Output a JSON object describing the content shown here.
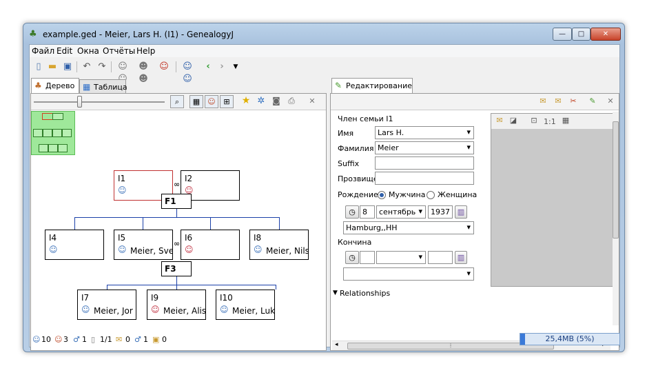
{
  "window": {
    "title": "example.ged - Meier, Lars H. (I1) - GenealogyJ",
    "controls": [
      "—",
      "□",
      "✕"
    ]
  },
  "menu": [
    "Файл",
    "Edit",
    "Окна",
    "Отчёты",
    "Help"
  ],
  "toolbar_icons": [
    "new-file-icon",
    "open-folder-icon",
    "save-icon",
    "undo-icon",
    "redo-icon",
    "people-icon",
    "family-icon",
    "add-person-icon",
    "relatives-icon",
    "back-arrow-icon",
    "forward-arrow-icon",
    "dropdown-icon"
  ],
  "left_tabs": [
    {
      "label": "Дерево",
      "active": true
    },
    {
      "label": "Таблица",
      "active": false
    }
  ],
  "tree": {
    "zoom_level": 0.33,
    "persons": [
      {
        "id": "I1",
        "name": "",
        "sex": "m",
        "selected": true
      },
      {
        "id": "I2",
        "name": "",
        "sex": "f"
      },
      {
        "id": "I4",
        "name": "",
        "sex": "m"
      },
      {
        "id": "I5",
        "name": "Meier, Sve",
        "sex": "m"
      },
      {
        "id": "I6",
        "name": "",
        "sex": "f"
      },
      {
        "id": "I8",
        "name": "Meier, Nils",
        "sex": "m"
      },
      {
        "id": "I7",
        "name": "Meier, Jor",
        "sex": "m"
      },
      {
        "id": "I9",
        "name": "Meier, Alis",
        "sex": "f"
      },
      {
        "id": "I10",
        "name": "Meier, Luk",
        "sex": "m"
      }
    ],
    "families": [
      "F1",
      "F3"
    ]
  },
  "right_tab": {
    "label": "Редактирование"
  },
  "editor": {
    "heading": "Член семьи I1",
    "given_label": "Имя",
    "given_value": "Lars H.",
    "surname_label": "Фамилия",
    "surname_value": "Meier",
    "suffix_label": "Suffix",
    "suffix_value": "",
    "nickname_label": "Прозвище",
    "nickname_value": "",
    "birth_label": "Рождение",
    "sex_male": "Мужчина",
    "sex_female": "Женщина",
    "sex_selected": "male",
    "birth_day": "8",
    "birth_month": "сентябрь",
    "birth_year": "1937",
    "birth_place": "Hamburg,,HH",
    "death_label": "Кончина",
    "death_day": "",
    "death_month": "",
    "death_year": "",
    "death_place": "",
    "relationships_label": "Relationships"
  },
  "image_pane": {
    "zoom_label": "1:1"
  },
  "status": {
    "persons": "10",
    "females": "3",
    "families": "1",
    "pages": "1/1",
    "notes": "0",
    "media": "1",
    "sources": "0",
    "memory": "25,4MB (5%)",
    "memory_fraction": 0.05
  }
}
